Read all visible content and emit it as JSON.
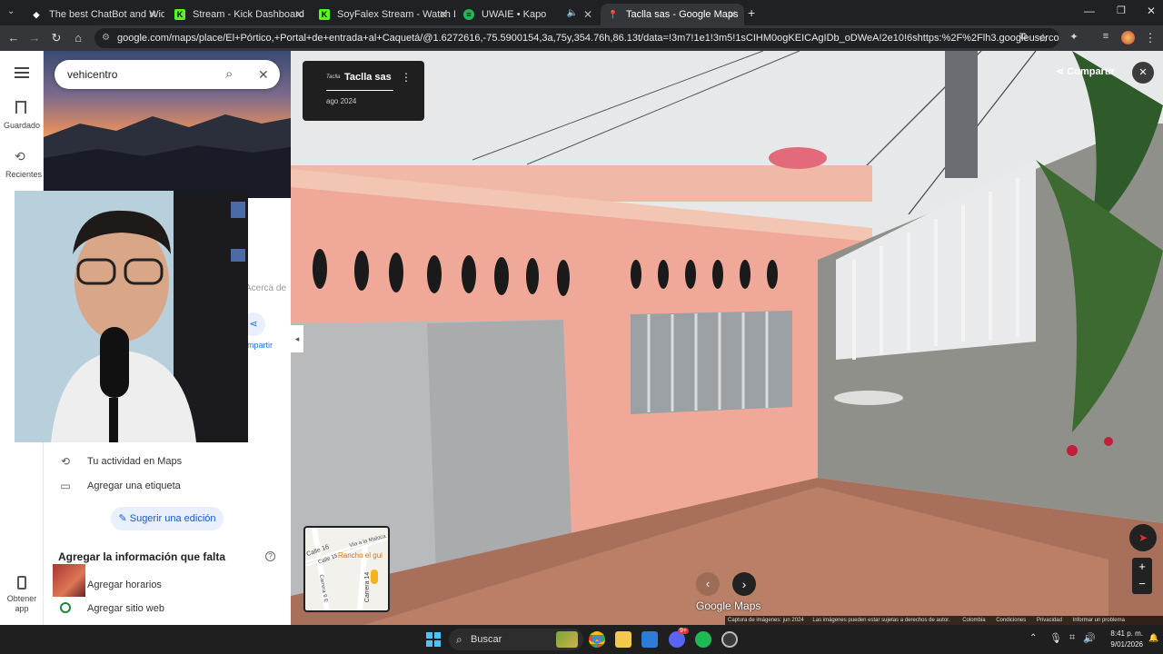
{
  "browser": {
    "tabs": [
      {
        "title": "The best ChatBot and Widgets",
        "active": false
      },
      {
        "title": "Stream - Kick Dashboard",
        "active": false
      },
      {
        "title": "SoyFalex Stream - Watch Live o",
        "active": false
      },
      {
        "title": "UWAIE • Kapo",
        "active": false
      },
      {
        "title": "Taclla sas - Google Maps",
        "active": true
      }
    ],
    "url": "google.com/maps/place/El+Pórtico,+Portal+de+entrada+al+Caquetá/@1.6272616,-75.5900154,3a,75y,354.76h,86.13t/data=!3m7!1e1!3m5!1sCIHM0ogKEICAgIDb_oDWeA!2e10!6shttps:%2F%2Flh3.googleusercontent.com%2Fgpms-cs-s%..."
  },
  "rail": {
    "items": [
      {
        "label": "Guardado",
        "icon": "bookmark-icon"
      },
      {
        "label": "Recientes",
        "icon": "history-icon"
      },
      {
        "label": "Obtener app",
        "icon": "phone-icon"
      }
    ]
  },
  "panel": {
    "search_value": "vehicentro",
    "partial_tab": "Acerca de",
    "partial_share": "mpartir",
    "actions": [
      {
        "label": "Tu actividad en Maps",
        "icon": "history-icon"
      },
      {
        "label": "Agregar una etiqueta",
        "icon": "label-icon"
      }
    ],
    "suggest_edit": "Sugerir una edición",
    "missing_info_title": "Agregar la información que falta",
    "missing_items": [
      {
        "label": "Agregar horarios"
      },
      {
        "label": "Agregar sitio web"
      }
    ]
  },
  "streetview": {
    "place_name": "Taclla sas",
    "place_logo_text": "Taclla",
    "date": "ago 2024",
    "share_label": "Compartir",
    "watermark": "Google Maps",
    "minimap_labels": [
      "Calle 16",
      "Calle 15",
      "Vía a la Maloca",
      "Rancho el gui",
      "Carrera 14",
      "Carrera 9 E"
    ],
    "footer": {
      "capture": "Captura de imágenes: jun 2024",
      "copyright": "Las imágenes pueden estar sujetas a derechos de autor.",
      "links": [
        "Colombia",
        "Condiciones",
        "Privacidad",
        "Informar un problema"
      ]
    }
  },
  "taskbar": {
    "search_placeholder": "Buscar",
    "time": "8:41 p. m.",
    "date": "9/01/2026",
    "discord_badge": "9+"
  }
}
